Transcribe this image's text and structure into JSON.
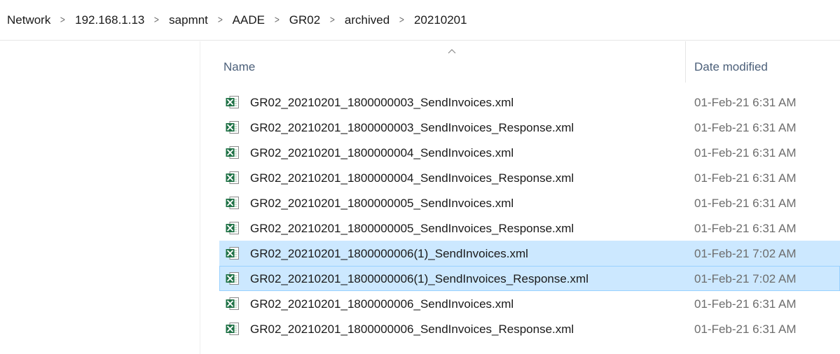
{
  "breadcrumb": {
    "items": [
      "Network",
      "192.168.1.13",
      "sapmnt",
      "AADE",
      "GR02",
      "archived",
      "20210201"
    ]
  },
  "columns": {
    "name": "Name",
    "date_modified": "Date modified",
    "sort": "ascending"
  },
  "icons": {
    "file": "excel-xml-file-icon",
    "separator": "chevron-right-icon",
    "sort": "sort-ascending-icon"
  },
  "colors": {
    "selection": "#cce8ff",
    "focus_border": "#99d1ff",
    "excel_green": "#1e7145",
    "header_text": "#4c607a"
  },
  "files": [
    {
      "name": "GR02_20210201_1800000003_SendInvoices.xml",
      "date": "01-Feb-21 6:31 AM",
      "selected": false,
      "focused": false
    },
    {
      "name": "GR02_20210201_1800000003_SendInvoices_Response.xml",
      "date": "01-Feb-21 6:31 AM",
      "selected": false,
      "focused": false
    },
    {
      "name": "GR02_20210201_1800000004_SendInvoices.xml",
      "date": "01-Feb-21 6:31 AM",
      "selected": false,
      "focused": false
    },
    {
      "name": "GR02_20210201_1800000004_SendInvoices_Response.xml",
      "date": "01-Feb-21 6:31 AM",
      "selected": false,
      "focused": false
    },
    {
      "name": "GR02_20210201_1800000005_SendInvoices.xml",
      "date": "01-Feb-21 6:31 AM",
      "selected": false,
      "focused": false
    },
    {
      "name": "GR02_20210201_1800000005_SendInvoices_Response.xml",
      "date": "01-Feb-21 6:31 AM",
      "selected": false,
      "focused": false
    },
    {
      "name": "GR02_20210201_1800000006(1)_SendInvoices.xml",
      "date": "01-Feb-21 7:02 AM",
      "selected": true,
      "focused": false
    },
    {
      "name": "GR02_20210201_1800000006(1)_SendInvoices_Response.xml",
      "date": "01-Feb-21 7:02 AM",
      "selected": true,
      "focused": true
    },
    {
      "name": "GR02_20210201_1800000006_SendInvoices.xml",
      "date": "01-Feb-21 6:31 AM",
      "selected": false,
      "focused": false
    },
    {
      "name": "GR02_20210201_1800000006_SendInvoices_Response.xml",
      "date": "01-Feb-21 6:31 AM",
      "selected": false,
      "focused": false
    }
  ]
}
